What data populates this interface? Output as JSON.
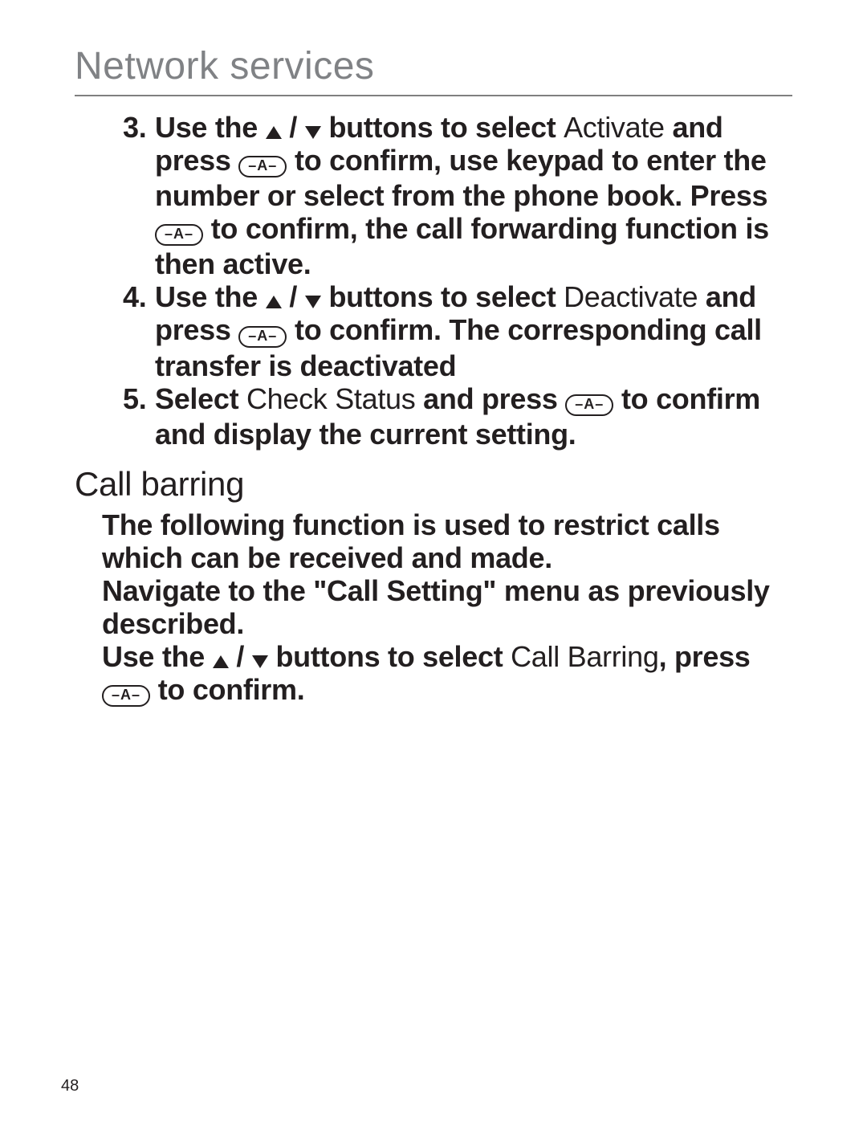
{
  "header": {
    "title": "Network services"
  },
  "steps": [
    {
      "num": "3.",
      "p1": "Use the ",
      "p2": " / ",
      "p3": " buttons to select ",
      "term1": "Activate",
      "p4": " and press ",
      "btn1": "–A–",
      "p5": " to confirm, use keypad to enter the number or select from the phone book. Press ",
      "btn2": "–A–",
      "p6": " to confirm, the call forwarding function is then active."
    },
    {
      "num": "4.",
      "p1": "Use the ",
      "p2": " / ",
      "p3": " buttons to select ",
      "term1": "Deactivate",
      "p4": " and press ",
      "btn1": "–A–",
      "p5": " to confirm. The corresponding call transfer is deactivated"
    },
    {
      "num": "5.",
      "p1": "Select ",
      "term1": "Check Status",
      "p2": " and press ",
      "btn1": "–A–",
      "p3": " to confirm and display the current setting."
    }
  ],
  "section": {
    "title": "Call barring",
    "para1": "The following function is used to restrict calls which can be received and made.",
    "para2": "Navigate to the \"Call Setting\" menu as previously described.",
    "p3a": "Use the ",
    "p3b": " / ",
    "p3c": " buttons to select ",
    "term": "Call Barring",
    "p3d": ", press ",
    "btn": "–A–",
    "p3e": " to confirm."
  },
  "page_number": "48"
}
